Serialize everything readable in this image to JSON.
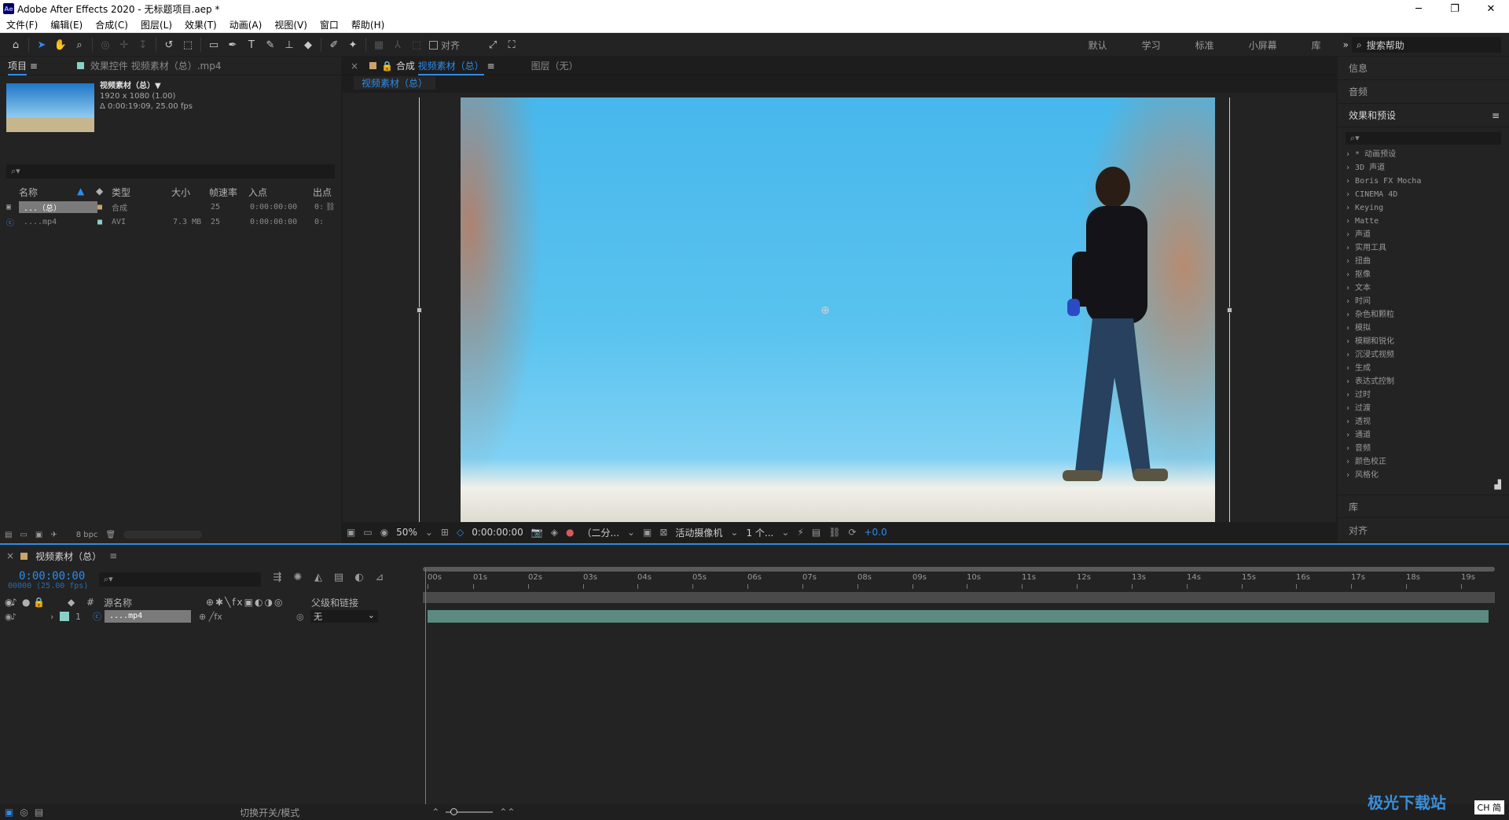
{
  "window": {
    "title": "Adobe After Effects 2020 - 无标题项目.aep *",
    "min": "─",
    "max": "❐",
    "close": "✕"
  },
  "menu": [
    "文件(F)",
    "编辑(E)",
    "合成(C)",
    "图层(L)",
    "效果(T)",
    "动画(A)",
    "视图(V)",
    "窗口",
    "帮助(H)"
  ],
  "toolbar": {
    "snap_label": "对齐"
  },
  "workspaces": [
    "默认",
    "学习",
    "标准",
    "小屏幕",
    "库"
  ],
  "search_help": {
    "placeholder": "搜索帮助"
  },
  "project_panel": {
    "tab_project": "项目",
    "tab_effects": "效果控件 视频素材（总）.mp4",
    "item_name": "视频素材（总）▼",
    "item_res": "1920 x 1080 (1.00)",
    "item_dur": "Δ 0:00:19:09, 25.00 fps",
    "columns": [
      "名称",
      "类型",
      "大小",
      "帧速率",
      "入点",
      "出点"
    ],
    "rows": [
      {
        "name": "...（总）",
        "type": "合成",
        "size": "",
        "fps": "25",
        "in": "0:00:00:00",
        "out": "0:"
      },
      {
        "name": "....mp4",
        "type": "AVI",
        "size": "7.3 MB",
        "fps": "25",
        "in": "0:00:00:00",
        "out": "0:"
      }
    ],
    "bpc": "8 bpc"
  },
  "comp_panel": {
    "tab_prefix": "合成",
    "tab_name": "视频素材（总）",
    "tab_layer": "图层（无）",
    "subtab": "视频素材（总）",
    "zoom": "50%",
    "time": "0:00:00:00",
    "resolution": "（二分...",
    "camera": "活动摄像机",
    "views": "1 个...",
    "exposure": "+0.0"
  },
  "right_panel": {
    "info": "信息",
    "audio": "音频",
    "effects": "效果和预设",
    "categories": [
      "* 动画预设",
      "3D 声道",
      "Boris FX Mocha",
      "CINEMA 4D",
      "Keying",
      "Matte",
      "声道",
      "实用工具",
      "扭曲",
      "抠像",
      "文本",
      "时间",
      "杂色和颗粒",
      "模拟",
      "模糊和锐化",
      "沉浸式视频",
      "生成",
      "表达式控制",
      "过时",
      "过渡",
      "透视",
      "通道",
      "音频",
      "颜色校正",
      "风格化"
    ],
    "library": "库",
    "align": "对齐"
  },
  "timeline": {
    "tab": "视频素材（总）",
    "time": "0:00:00:00",
    "fps": "00000 (25.00 fps)",
    "col_source": "源名称",
    "col_parent": "父级和链接",
    "layer_num": "1",
    "layer_name": "....mp4",
    "layer_parent": "无",
    "ruler": [
      "00s",
      "01s",
      "02s",
      "03s",
      "04s",
      "05s",
      "06s",
      "07s",
      "08s",
      "09s",
      "10s",
      "11s",
      "12s",
      "13s",
      "14s",
      "15s",
      "16s",
      "17s",
      "18s",
      "19s"
    ],
    "footer": "切换开关/模式"
  },
  "watermark": "极光下载站",
  "ime": "CH 简"
}
